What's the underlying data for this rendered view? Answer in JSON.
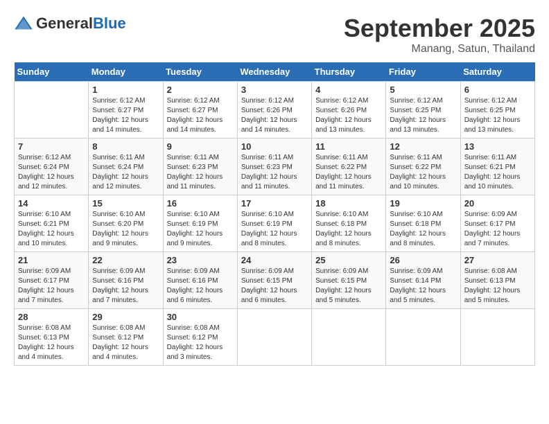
{
  "header": {
    "logo_general": "General",
    "logo_blue": "Blue",
    "month_year": "September 2025",
    "location": "Manang, Satun, Thailand"
  },
  "weekdays": [
    "Sunday",
    "Monday",
    "Tuesday",
    "Wednesday",
    "Thursday",
    "Friday",
    "Saturday"
  ],
  "weeks": [
    [
      {
        "day": "",
        "info": ""
      },
      {
        "day": "1",
        "info": "Sunrise: 6:12 AM\nSunset: 6:27 PM\nDaylight: 12 hours\nand 14 minutes."
      },
      {
        "day": "2",
        "info": "Sunrise: 6:12 AM\nSunset: 6:27 PM\nDaylight: 12 hours\nand 14 minutes."
      },
      {
        "day": "3",
        "info": "Sunrise: 6:12 AM\nSunset: 6:26 PM\nDaylight: 12 hours\nand 14 minutes."
      },
      {
        "day": "4",
        "info": "Sunrise: 6:12 AM\nSunset: 6:26 PM\nDaylight: 12 hours\nand 13 minutes."
      },
      {
        "day": "5",
        "info": "Sunrise: 6:12 AM\nSunset: 6:25 PM\nDaylight: 12 hours\nand 13 minutes."
      },
      {
        "day": "6",
        "info": "Sunrise: 6:12 AM\nSunset: 6:25 PM\nDaylight: 12 hours\nand 13 minutes."
      }
    ],
    [
      {
        "day": "7",
        "info": "Sunrise: 6:12 AM\nSunset: 6:24 PM\nDaylight: 12 hours\nand 12 minutes."
      },
      {
        "day": "8",
        "info": "Sunrise: 6:11 AM\nSunset: 6:24 PM\nDaylight: 12 hours\nand 12 minutes."
      },
      {
        "day": "9",
        "info": "Sunrise: 6:11 AM\nSunset: 6:23 PM\nDaylight: 12 hours\nand 11 minutes."
      },
      {
        "day": "10",
        "info": "Sunrise: 6:11 AM\nSunset: 6:23 PM\nDaylight: 12 hours\nand 11 minutes."
      },
      {
        "day": "11",
        "info": "Sunrise: 6:11 AM\nSunset: 6:22 PM\nDaylight: 12 hours\nand 11 minutes."
      },
      {
        "day": "12",
        "info": "Sunrise: 6:11 AM\nSunset: 6:22 PM\nDaylight: 12 hours\nand 10 minutes."
      },
      {
        "day": "13",
        "info": "Sunrise: 6:11 AM\nSunset: 6:21 PM\nDaylight: 12 hours\nand 10 minutes."
      }
    ],
    [
      {
        "day": "14",
        "info": "Sunrise: 6:10 AM\nSunset: 6:21 PM\nDaylight: 12 hours\nand 10 minutes."
      },
      {
        "day": "15",
        "info": "Sunrise: 6:10 AM\nSunset: 6:20 PM\nDaylight: 12 hours\nand 9 minutes."
      },
      {
        "day": "16",
        "info": "Sunrise: 6:10 AM\nSunset: 6:19 PM\nDaylight: 12 hours\nand 9 minutes."
      },
      {
        "day": "17",
        "info": "Sunrise: 6:10 AM\nSunset: 6:19 PM\nDaylight: 12 hours\nand 8 minutes."
      },
      {
        "day": "18",
        "info": "Sunrise: 6:10 AM\nSunset: 6:18 PM\nDaylight: 12 hours\nand 8 minutes."
      },
      {
        "day": "19",
        "info": "Sunrise: 6:10 AM\nSunset: 6:18 PM\nDaylight: 12 hours\nand 8 minutes."
      },
      {
        "day": "20",
        "info": "Sunrise: 6:09 AM\nSunset: 6:17 PM\nDaylight: 12 hours\nand 7 minutes."
      }
    ],
    [
      {
        "day": "21",
        "info": "Sunrise: 6:09 AM\nSunset: 6:17 PM\nDaylight: 12 hours\nand 7 minutes."
      },
      {
        "day": "22",
        "info": "Sunrise: 6:09 AM\nSunset: 6:16 PM\nDaylight: 12 hours\nand 7 minutes."
      },
      {
        "day": "23",
        "info": "Sunrise: 6:09 AM\nSunset: 6:16 PM\nDaylight: 12 hours\nand 6 minutes."
      },
      {
        "day": "24",
        "info": "Sunrise: 6:09 AM\nSunset: 6:15 PM\nDaylight: 12 hours\nand 6 minutes."
      },
      {
        "day": "25",
        "info": "Sunrise: 6:09 AM\nSunset: 6:15 PM\nDaylight: 12 hours\nand 5 minutes."
      },
      {
        "day": "26",
        "info": "Sunrise: 6:09 AM\nSunset: 6:14 PM\nDaylight: 12 hours\nand 5 minutes."
      },
      {
        "day": "27",
        "info": "Sunrise: 6:08 AM\nSunset: 6:13 PM\nDaylight: 12 hours\nand 5 minutes."
      }
    ],
    [
      {
        "day": "28",
        "info": "Sunrise: 6:08 AM\nSunset: 6:13 PM\nDaylight: 12 hours\nand 4 minutes."
      },
      {
        "day": "29",
        "info": "Sunrise: 6:08 AM\nSunset: 6:12 PM\nDaylight: 12 hours\nand 4 minutes."
      },
      {
        "day": "30",
        "info": "Sunrise: 6:08 AM\nSunset: 6:12 PM\nDaylight: 12 hours\nand 3 minutes."
      },
      {
        "day": "",
        "info": ""
      },
      {
        "day": "",
        "info": ""
      },
      {
        "day": "",
        "info": ""
      },
      {
        "day": "",
        "info": ""
      }
    ]
  ]
}
